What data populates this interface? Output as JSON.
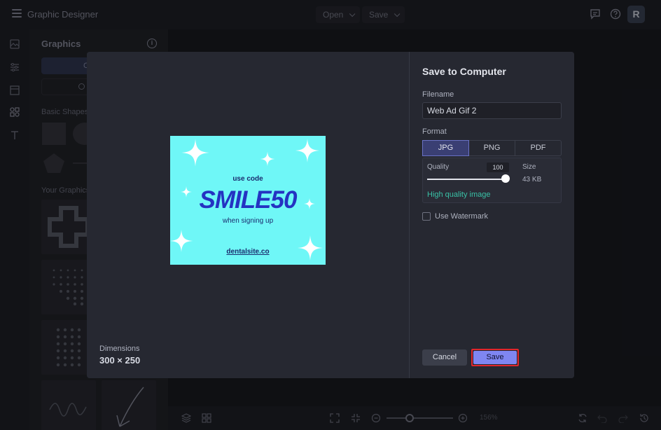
{
  "app": {
    "title": "Graphic Designer",
    "open_label": "Open",
    "save_label": "Save",
    "avatar_initial": "R"
  },
  "panel": {
    "title": "Graphics",
    "create_label": "C",
    "search_label": "Se",
    "basic_shapes_label": "Basic Shapes",
    "your_graphics_label": "Your Graphics"
  },
  "canvas_toolbar": {
    "zoom_level": "156%"
  },
  "modal": {
    "title": "Save to Computer",
    "filename_label": "Filename",
    "filename_value": "Web Ad Gif 2",
    "format_label": "Format",
    "formats": [
      "JPG",
      "PNG",
      "PDF"
    ],
    "selected_format": "JPG",
    "quality_label": "Quality",
    "quality_value": "100",
    "size_label": "Size",
    "size_value": "43 KB",
    "quality_note": "High quality image",
    "watermark_label": "Use Watermark",
    "watermark_checked": false,
    "dimensions_label": "Dimensions",
    "dimensions_value": "300 × 250",
    "cancel_label": "Cancel",
    "save_label": "Save"
  },
  "artwork": {
    "line1": "use code",
    "headline": "SMILE50",
    "line2": "when signing up",
    "website": "dentalsite.co",
    "background_color": "#6ff7f7",
    "text_color": "#2433c2"
  },
  "colors": {
    "accent": "#7f86f2",
    "highlight_border": "#e2262c",
    "link_green": "#39c1a6"
  }
}
